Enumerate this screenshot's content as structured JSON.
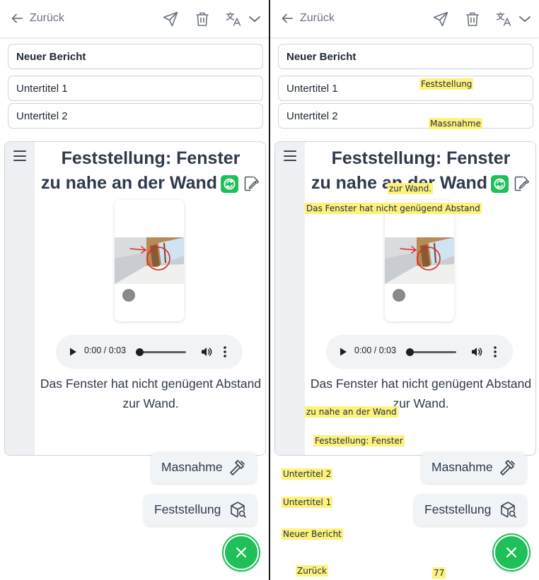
{
  "topbar": {
    "back_label": "Zurück",
    "icons": [
      "arrow-left-icon",
      "send-icon",
      "trash-icon",
      "translate-icon",
      "chevron-down-icon"
    ]
  },
  "report": {
    "title_field": "Neuer Bericht",
    "subtitle1_field": "Untertitel 1",
    "subtitle2_field": "Untertitel 2"
  },
  "card": {
    "title_line1": "Feststellung: Fenster",
    "title_line2": "zu nahe an der Wand",
    "description": "Das Fenster hat nicht genügent Abstand zur Wand.",
    "audio_time": "0:00 / 0:03",
    "audio_progress": 0
  },
  "actions": {
    "masnahme_label": "Masnahme",
    "feststellung_label": "Feststellung"
  },
  "overlay_tags": {
    "feststellung": "Feststellung",
    "massnahme": "Massnahme",
    "zur_wand": "zur Wand.",
    "abstand": "Das Fenster hat nicht genügend Abstand",
    "zu_nahe": "zu nahe an der Wand",
    "fenster": "Feststellung: Fenster",
    "untertitel2": "Untertitel 2",
    "untertitel1": "Untertitel 1",
    "neuer_bericht": "Neuer Bericht",
    "zurueck": "Zurück",
    "number": "77"
  },
  "colors": {
    "accent_green": "#1fbf5a",
    "tag_yellow": "#fff27a",
    "text_dark": "#2f3a4a"
  }
}
